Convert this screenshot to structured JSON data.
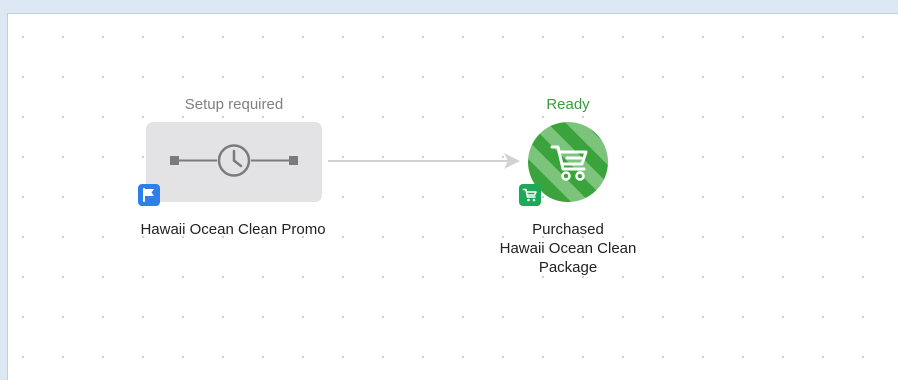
{
  "canvas": {
    "nodes": [
      {
        "status": "Setup required",
        "status_color": "#808080",
        "type_icon": "timer-clock-icon",
        "badge_icon": "flag-icon",
        "badge_color": "#2f7fe9",
        "label": "Hawaii Ocean Clean Promo"
      },
      {
        "status": "Ready",
        "status_color": "#3c9a3c",
        "type_icon": "shopping-cart-icon",
        "badge_icon": "shopping-cart-icon",
        "badge_color": "#1daa57",
        "label_lines": [
          "Purchased",
          "Hawaii Ocean Clean",
          "Package"
        ]
      }
    ],
    "connector_icon": "arrow-right-icon"
  }
}
